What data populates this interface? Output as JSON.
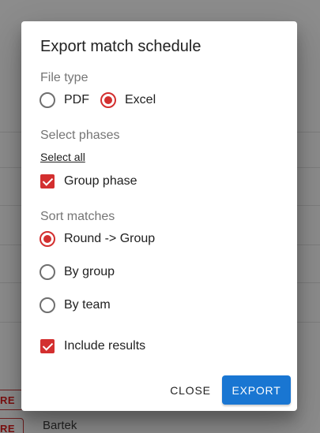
{
  "background": {
    "chip_label": "ORE",
    "player_name": "Bartek"
  },
  "dialog": {
    "title": "Export match schedule",
    "file_type": {
      "label": "File type",
      "options": [
        {
          "label": "PDF",
          "checked": false
        },
        {
          "label": "Excel",
          "checked": true
        }
      ]
    },
    "phases": {
      "label": "Select phases",
      "select_all": "Select all",
      "items": [
        {
          "label": "Group phase",
          "checked": true
        }
      ]
    },
    "sort": {
      "label": "Sort matches",
      "options": [
        {
          "label": "Round -> Group",
          "checked": true
        },
        {
          "label": "By group",
          "checked": false
        },
        {
          "label": "By team",
          "checked": false
        }
      ]
    },
    "include_results": {
      "label": "Include results",
      "checked": true
    },
    "actions": {
      "close": "CLOSE",
      "export": "EXPORT"
    }
  },
  "colors": {
    "accent": "#d32f2f",
    "primary": "#1976d2"
  }
}
